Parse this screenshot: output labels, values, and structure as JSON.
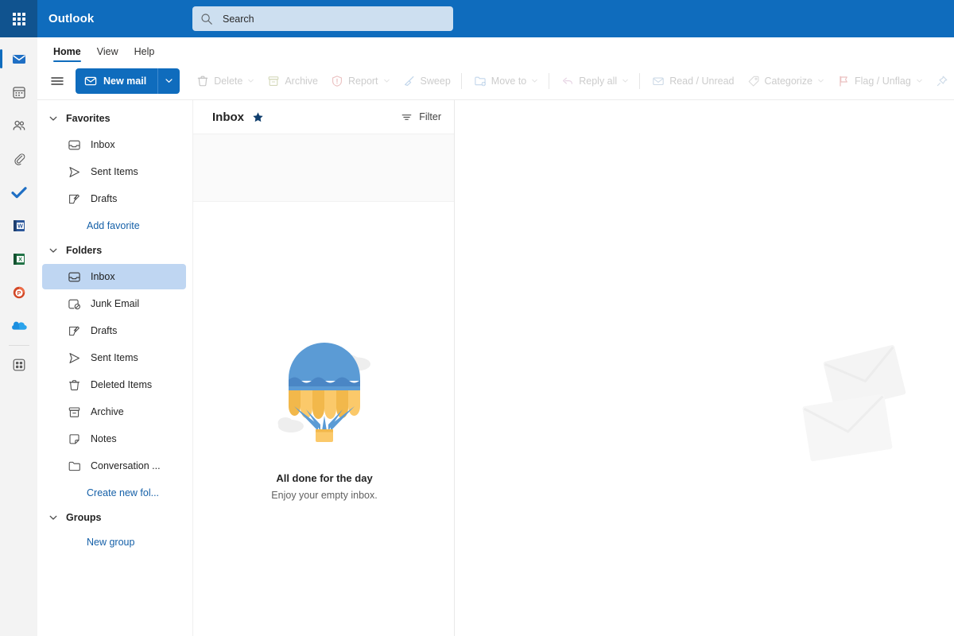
{
  "app": {
    "name": "Outlook",
    "accent_color": "#0f6cbd",
    "topbar_color": "#0f6cbd",
    "waffle_color": "#10538f",
    "search_field_color": "#cddff0",
    "selection_color": "#bfd6f2",
    "link_color": "#1560a8"
  },
  "topbar": {
    "waffle_icon": "app-launcher-waffle-icon",
    "brand": "Outlook",
    "search": {
      "icon": "search-icon",
      "placeholder": "Search",
      "value": ""
    }
  },
  "rail": {
    "items": [
      {
        "icon": "mail-icon",
        "label": "Mail",
        "selected": true
      },
      {
        "icon": "calendar-icon",
        "label": "Calendar",
        "selected": false
      },
      {
        "icon": "people-icon",
        "label": "People",
        "selected": false
      },
      {
        "icon": "paperclip-icon",
        "label": "Files",
        "selected": false
      },
      {
        "icon": "todo-check-icon",
        "label": "To Do",
        "selected": false
      },
      {
        "icon": "word-icon",
        "label": "Word",
        "selected": false
      },
      {
        "icon": "excel-icon",
        "label": "Excel",
        "selected": false
      },
      {
        "icon": "powerpoint-icon",
        "label": "PowerPoint",
        "selected": false
      },
      {
        "icon": "onedrive-icon",
        "label": "OneDrive",
        "selected": false
      },
      {
        "icon": "apps-grid-icon",
        "label": "Apps",
        "selected": false
      }
    ]
  },
  "ribbon": {
    "tabs": [
      {
        "label": "Home",
        "active": true
      },
      {
        "label": "View",
        "active": false
      },
      {
        "label": "Help",
        "active": false
      }
    ]
  },
  "commandbar": {
    "hamburger_icon": "hamburger-menu-icon",
    "new_mail": {
      "label": "New mail",
      "icon": "mail-icon",
      "caret_icon": "chevron-down-icon",
      "enabled": true
    },
    "commands": [
      {
        "label": "Delete",
        "icon": "trash-icon",
        "caret": true,
        "enabled": false
      },
      {
        "label": "Archive",
        "icon": "archive-box-icon",
        "caret": false,
        "enabled": false
      },
      {
        "label": "Report",
        "icon": "shield-alert-icon",
        "caret": true,
        "enabled": false
      },
      {
        "label": "Sweep",
        "icon": "broom-icon",
        "caret": false,
        "enabled": false
      },
      {
        "label": "Move to",
        "icon": "folder-move-icon",
        "caret": true,
        "enabled": false
      },
      {
        "label": "Reply all",
        "icon": "reply-all-arrow-icon",
        "caret": true,
        "enabled": false
      },
      {
        "label": "Read / Unread",
        "icon": "open-envelope-icon",
        "caret": false,
        "enabled": false
      },
      {
        "label": "Categorize",
        "icon": "tag-icon",
        "caret": true,
        "enabled": false
      },
      {
        "label": "Flag / Unflag",
        "icon": "flag-icon",
        "caret": true,
        "enabled": false
      },
      {
        "label": "Pin",
        "icon": "pin-icon",
        "caret": false,
        "enabled": false
      }
    ]
  },
  "sidebar": {
    "sections": [
      {
        "name": "Favorites",
        "label": "Favorites",
        "chevron_icon": "chevron-down-icon",
        "expanded": true,
        "items": [
          {
            "label": "Inbox",
            "icon": "inbox-icon",
            "selected": false
          },
          {
            "label": "Sent Items",
            "icon": "send-icon",
            "selected": false
          },
          {
            "label": "Drafts",
            "icon": "draft-pencil-icon",
            "selected": false
          }
        ],
        "action": {
          "label": "Add favorite",
          "name": "add-favorite-link"
        }
      },
      {
        "name": "Folders",
        "label": "Folders",
        "chevron_icon": "chevron-down-icon",
        "expanded": true,
        "items": [
          {
            "label": "Inbox",
            "icon": "inbox-icon",
            "selected": true
          },
          {
            "label": "Junk Email",
            "icon": "junk-mail-icon",
            "selected": false
          },
          {
            "label": "Drafts",
            "icon": "draft-pencil-icon",
            "selected": false
          },
          {
            "label": "Sent Items",
            "icon": "send-icon",
            "selected": false
          },
          {
            "label": "Deleted Items",
            "icon": "trash-icon",
            "selected": false
          },
          {
            "label": "Archive",
            "icon": "archive-box-icon",
            "selected": false
          },
          {
            "label": "Notes",
            "icon": "note-icon",
            "selected": false
          },
          {
            "label": "Conversation ...",
            "icon": "folder-icon",
            "selected": false
          }
        ],
        "action": {
          "label": "Create new fol...",
          "name": "create-new-folder-link"
        }
      },
      {
        "name": "Groups",
        "label": "Groups",
        "chevron_icon": "chevron-down-icon",
        "expanded": true,
        "items": [],
        "action": {
          "label": "New group",
          "name": "new-group-link"
        }
      }
    ]
  },
  "messagelist": {
    "title": "Inbox",
    "star_icon": "star-filled-icon",
    "filter": {
      "label": "Filter",
      "icon": "filter-icon"
    },
    "empty_state": {
      "illustration": "hot-air-balloon-illustration",
      "title": "All done for the day",
      "subtitle": "Enjoy your empty inbox."
    }
  },
  "readingpane": {
    "watermark_icon": "two-envelopes-watermark-icon",
    "content": ""
  }
}
